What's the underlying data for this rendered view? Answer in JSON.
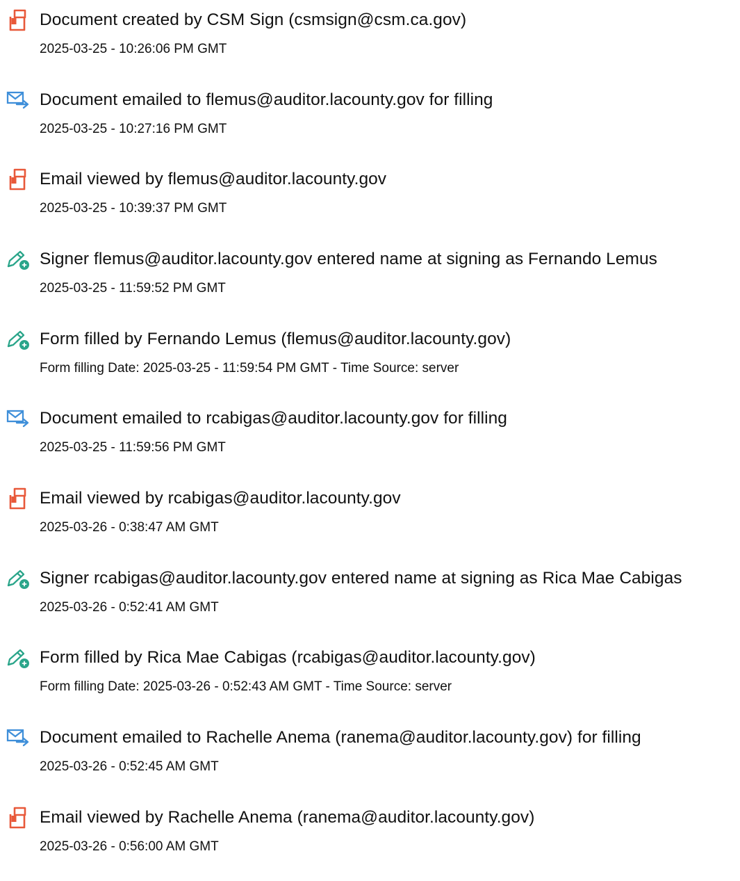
{
  "colors": {
    "doc_icon": "#e8593a",
    "mail_icon": "#3f8fd9",
    "sign_icon": "#2aa58a"
  },
  "events": [
    {
      "icon": "document-icon",
      "title": "Document created by CSM Sign (csmsign@csm.ca.gov)",
      "detail": "2025-03-25 - 10:26:06 PM GMT"
    },
    {
      "icon": "email-sent-icon",
      "title": "Document emailed to flemus@auditor.lacounty.gov for filling",
      "detail": "2025-03-25 - 10:27:16 PM GMT"
    },
    {
      "icon": "document-icon",
      "title": "Email viewed by flemus@auditor.lacounty.gov",
      "detail": "2025-03-25 - 10:39:37 PM GMT"
    },
    {
      "icon": "signature-pen-icon",
      "title": "Signer flemus@auditor.lacounty.gov entered name at signing as Fernando Lemus",
      "detail": "2025-03-25 - 11:59:52 PM GMT"
    },
    {
      "icon": "signature-pen-icon",
      "title": "Form filled by Fernando Lemus (flemus@auditor.lacounty.gov)",
      "detail": "Form filling Date: 2025-03-25 - 11:59:54 PM GMT - Time Source: server"
    },
    {
      "icon": "email-sent-icon",
      "title": "Document emailed to rcabigas@auditor.lacounty.gov for filling",
      "detail": "2025-03-25 - 11:59:56 PM GMT"
    },
    {
      "icon": "document-icon",
      "title": "Email viewed by rcabigas@auditor.lacounty.gov",
      "detail": "2025-03-26 - 0:38:47 AM GMT"
    },
    {
      "icon": "signature-pen-icon",
      "title": "Signer rcabigas@auditor.lacounty.gov entered name at signing as Rica Mae Cabigas",
      "detail": "2025-03-26 - 0:52:41 AM GMT"
    },
    {
      "icon": "signature-pen-icon",
      "title": "Form filled by Rica Mae Cabigas (rcabigas@auditor.lacounty.gov)",
      "detail": "Form filling Date: 2025-03-26 - 0:52:43 AM GMT - Time Source: server"
    },
    {
      "icon": "email-sent-icon",
      "title": "Document emailed to Rachelle Anema (ranema@auditor.lacounty.gov) for filling",
      "detail": "2025-03-26 - 0:52:45 AM GMT"
    },
    {
      "icon": "document-icon",
      "title": "Email viewed by Rachelle Anema (ranema@auditor.lacounty.gov)",
      "detail": "2025-03-26 - 0:56:00 AM GMT"
    }
  ]
}
